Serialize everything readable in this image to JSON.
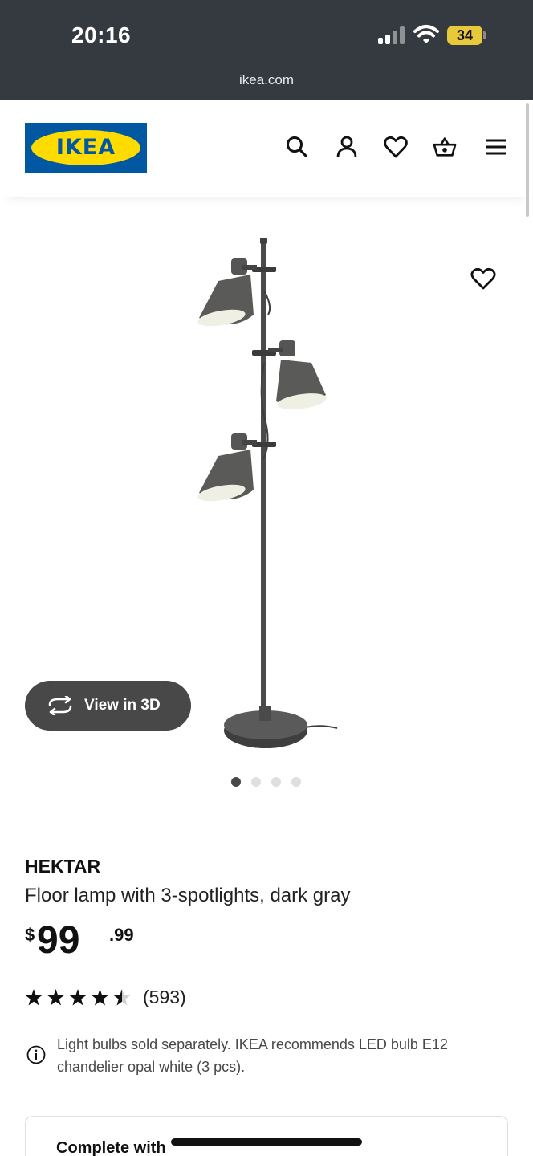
{
  "status_bar": {
    "time": "20:16",
    "battery": "34",
    "url": "ikea.com",
    "icons": [
      "cellular-signal-icon",
      "wifi-icon",
      "battery-icon"
    ]
  },
  "header": {
    "logo_text": "IKEA",
    "icons": [
      "search-icon",
      "account-icon",
      "favorites-heart-icon",
      "shopping-basket-icon",
      "menu-icon"
    ],
    "colors": {
      "logo_blue": "#0058a3",
      "logo_yellow": "#ffdb00"
    }
  },
  "product_image": {
    "view_3d_label": "View in 3D",
    "carousel": {
      "total": 4,
      "active": 1
    }
  },
  "product": {
    "name": "HEKTAR",
    "description": "Floor lamp with 3-spotlights, dark gray",
    "price_currency": "$",
    "price_integer": "99",
    "price_decimal": ".99",
    "rating": 4.5,
    "rating_max": 5,
    "review_count": "(593)",
    "note": "Light bulbs sold separately. IKEA recommends LED bulb E12 chandelier opal white (3 pcs)."
  },
  "complete_with": {
    "title": "Complete with"
  }
}
